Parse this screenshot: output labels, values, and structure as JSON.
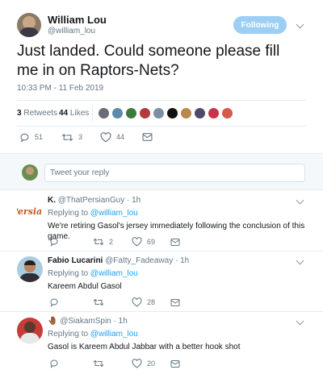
{
  "main_tweet": {
    "author_name": "William Lou",
    "author_handle": "@william_lou",
    "follow_label": "Following",
    "text": "Just landed. Could someone please fill me in on Raptors-Nets?",
    "timestamp": "10:33 PM - 11 Feb 2019",
    "retweets_count": "3",
    "retweets_label": "Retweets",
    "likes_count": "44",
    "likes_label": "Likes",
    "replies_action_count": "51",
    "retweets_action_count": "3",
    "likes_action_count": "44"
  },
  "reply_box": {
    "placeholder": "Tweet your reply"
  },
  "replies": [
    {
      "name": "K.",
      "handle": "@ThatPersianGuy",
      "time": "· 1h",
      "avatar_text": "Persian",
      "replying_label": "Replying to",
      "replying_to": "@william_lou",
      "text": "We're retiring Gasol's jersey immediately following the conclusion of this game.",
      "reply_count": "",
      "retweet_count": "2",
      "like_count": "69"
    },
    {
      "name": "Fabio Lucarini",
      "handle": "@Fatty_Fadeaway",
      "time": "· 1h",
      "replying_label": "Replying to",
      "replying_to": "@william_lou",
      "text": "Kareem Abdul Gasol",
      "reply_count": "",
      "retweet_count": "",
      "like_count": "28"
    },
    {
      "name": "🤚🏾",
      "handle": "@SiakamSpin",
      "time": "· 1h",
      "replying_label": "Replying to",
      "replying_to": "@william_lou",
      "text": "Gasol is Kareem Abdul Jabbar with a better hook shot",
      "reply_count": "",
      "retweet_count": "",
      "like_count": "20"
    }
  ],
  "colors": {
    "accent": "#1da1f2",
    "follow_bg": "#9dcff4",
    "muted": "#657786",
    "divider": "#e6ecf0"
  }
}
